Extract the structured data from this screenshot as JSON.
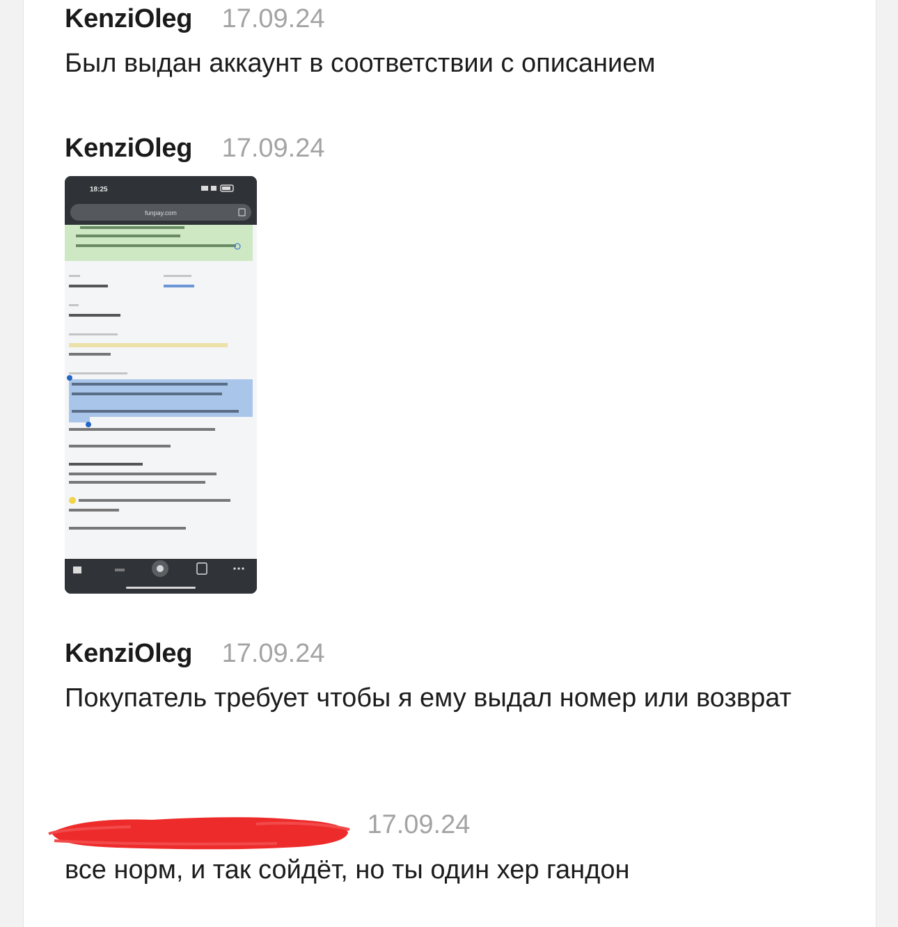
{
  "messages": [
    {
      "author": "KenziOleg",
      "date": "17.09.24",
      "text": "Был выдан аккаунт в соответствии с описанием"
    },
    {
      "author": "KenziOleg",
      "date": "17.09.24",
      "attachment": "screenshot"
    },
    {
      "author": "KenziOleg",
      "date": "17.09.24",
      "text": "Покупатель требует чтобы я ему выдал номер или возврат"
    },
    {
      "author": "",
      "author_redacted": true,
      "date": "17.09.24",
      "text": "все норм, и так сойдёт, но ты один хер гандон"
    }
  ],
  "attachment": {
    "status_time": "18:25",
    "url": "funpay.com"
  },
  "colors": {
    "author": "#1a1a1a",
    "date": "#a3a3a3",
    "redaction": "#ee2b2b"
  }
}
